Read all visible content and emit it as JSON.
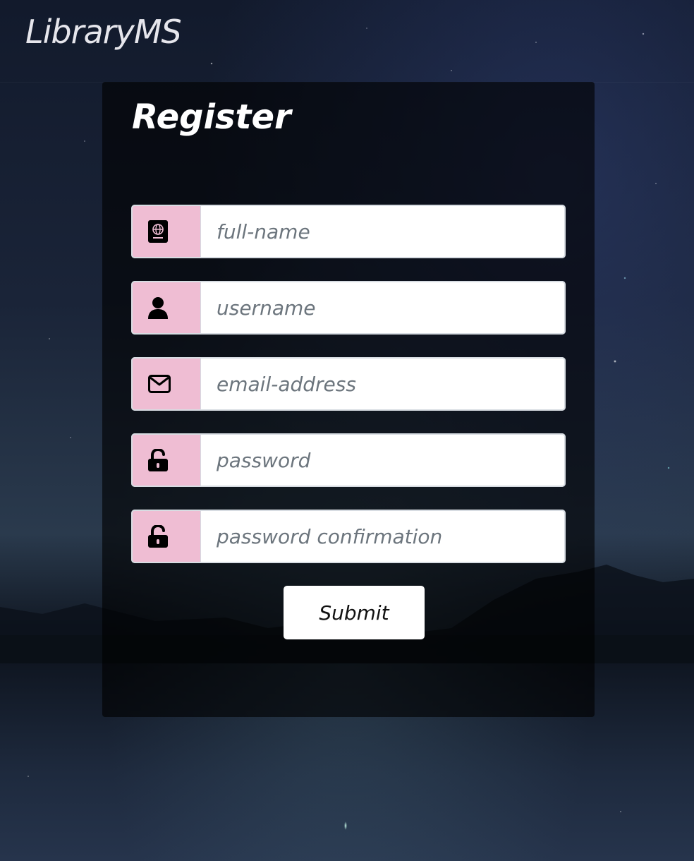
{
  "brand": {
    "name": "LibraryMS"
  },
  "form": {
    "title": "Register",
    "fields": [
      {
        "icon": "passport-icon",
        "placeholder": "full-name",
        "value": ""
      },
      {
        "icon": "user-icon",
        "placeholder": "username",
        "value": ""
      },
      {
        "icon": "envelope-icon",
        "placeholder": "email-address",
        "value": ""
      },
      {
        "icon": "unlock-icon",
        "placeholder": "password",
        "value": ""
      },
      {
        "icon": "unlock-icon",
        "placeholder": "password confirmation",
        "value": ""
      }
    ],
    "submit_label": "Submit"
  },
  "colors": {
    "addon_background": "#efbdd3",
    "panel_background": "rgba(0,0,0,0.62)",
    "input_border": "#d7dce2",
    "placeholder_text": "#6c757d"
  }
}
